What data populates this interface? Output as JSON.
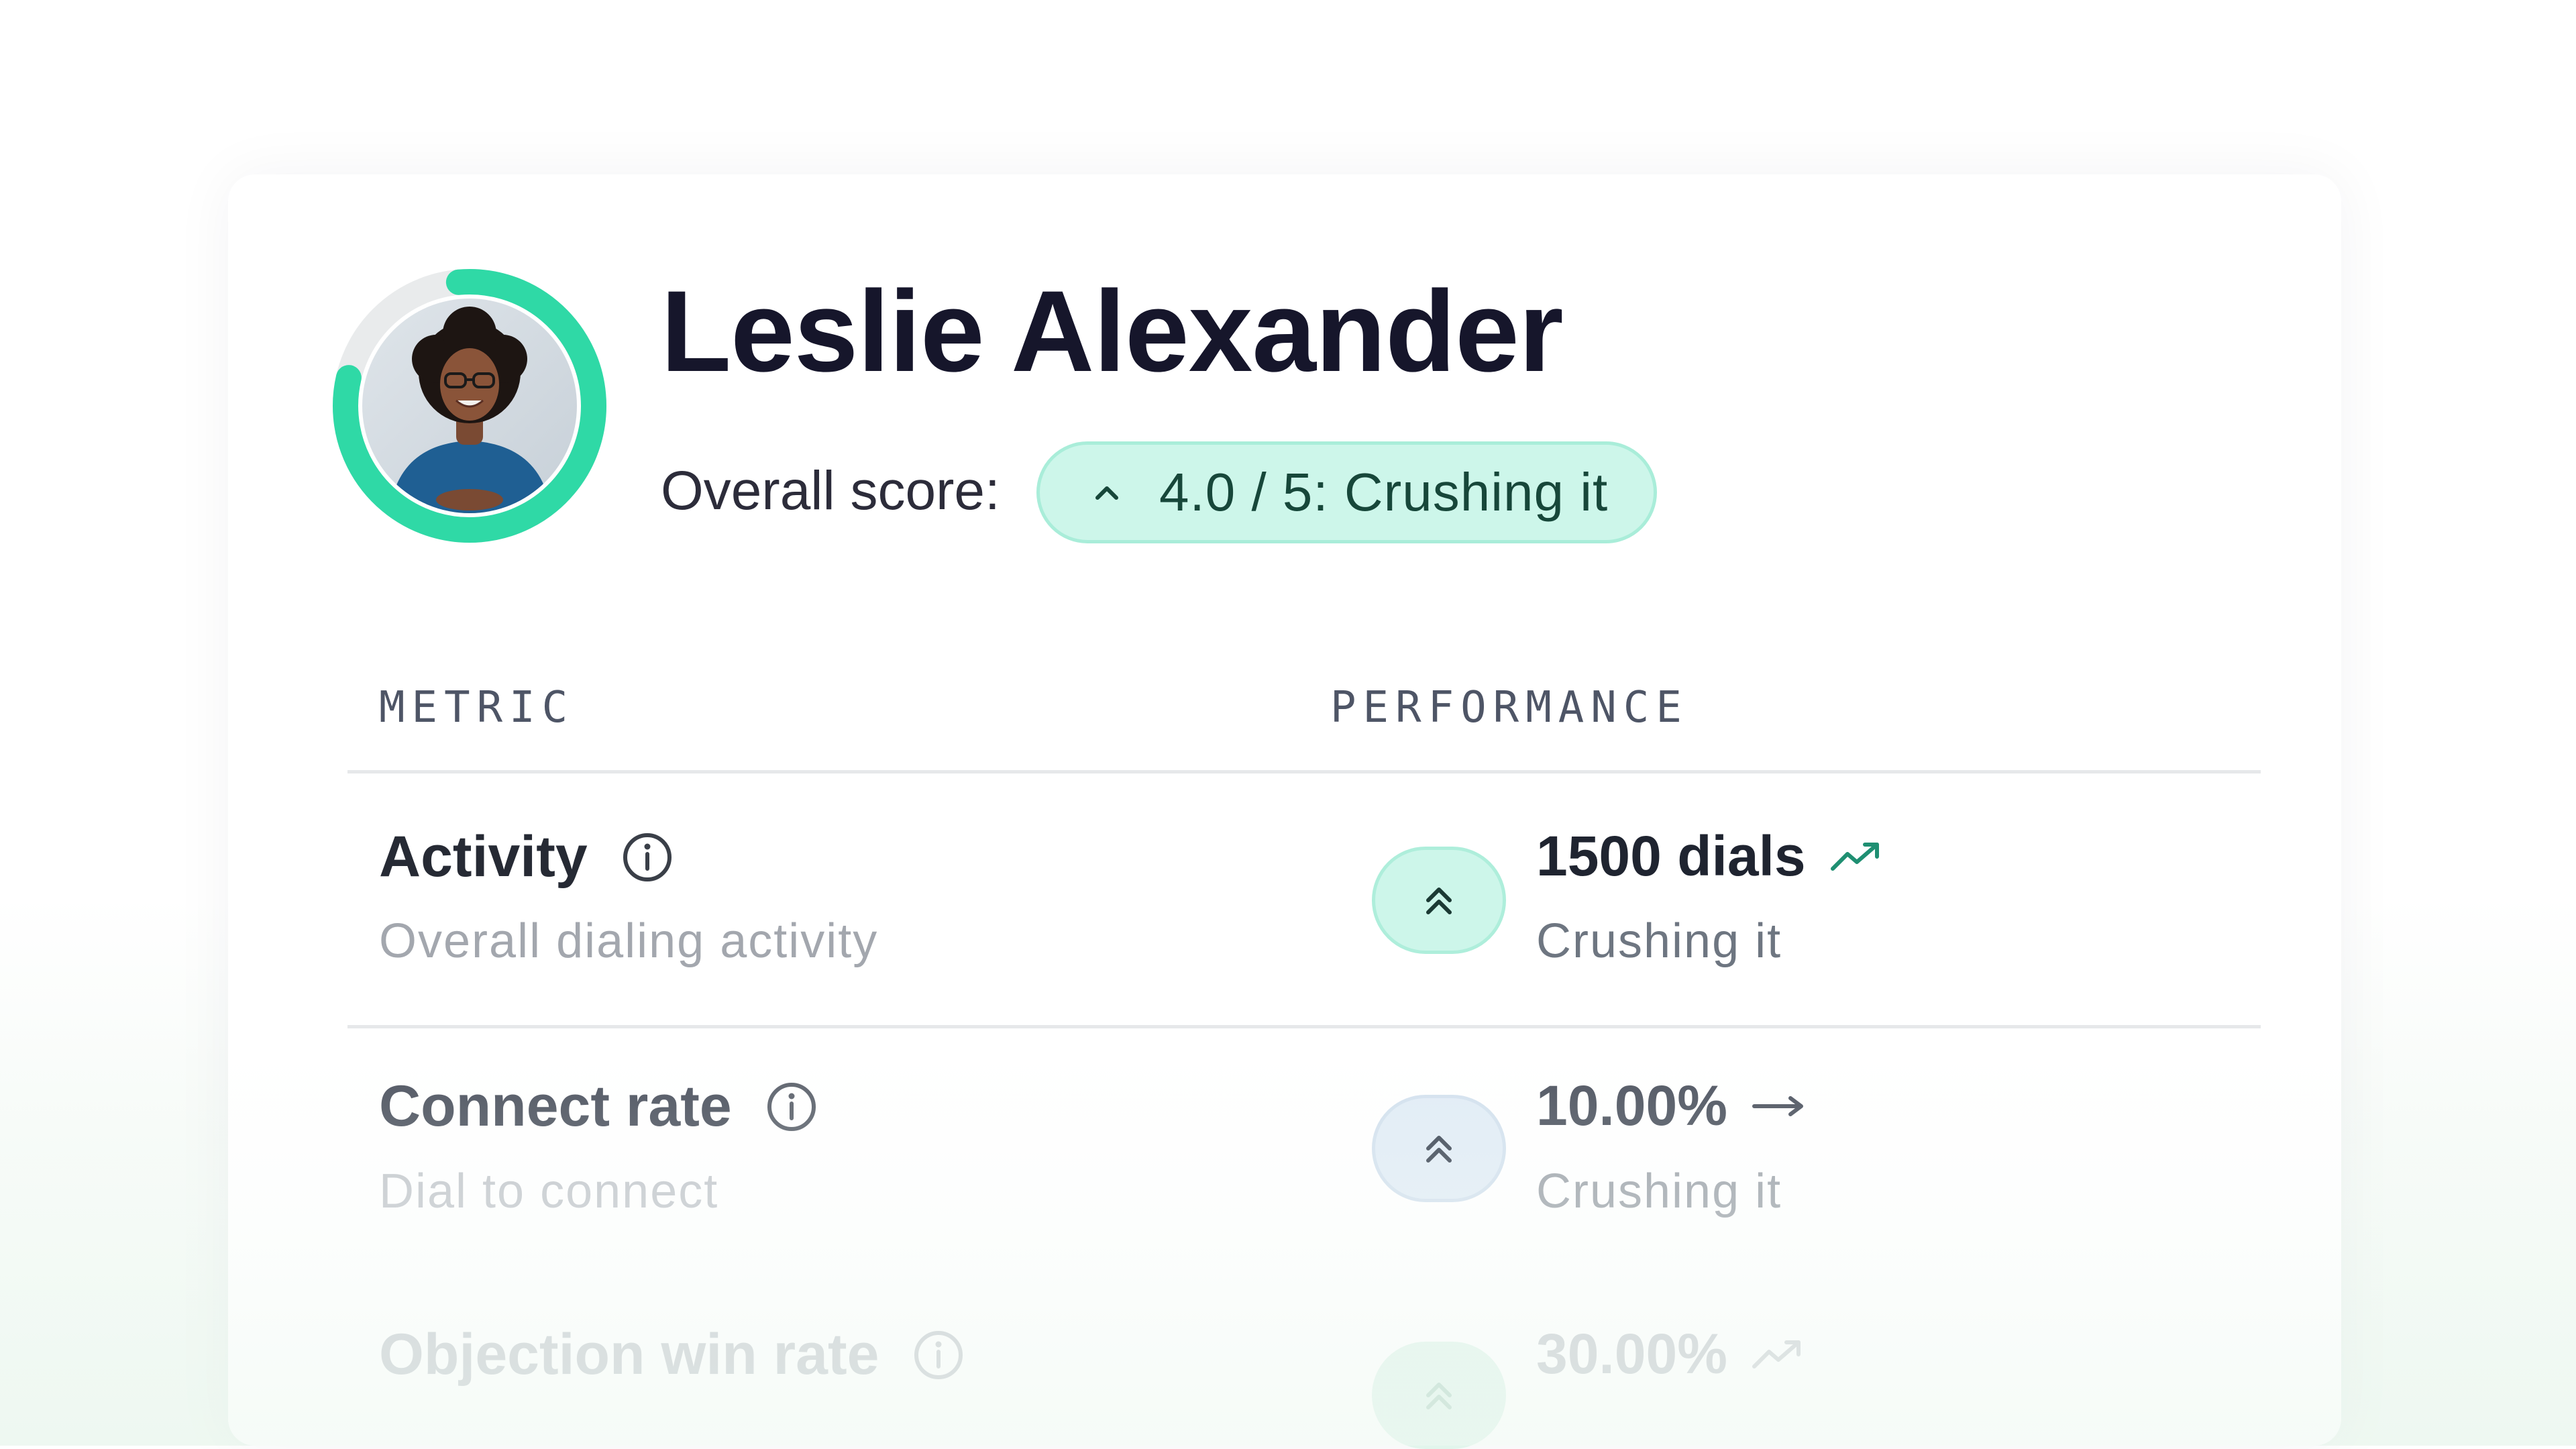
{
  "profile": {
    "name": "Leslie Alexander",
    "score_label": "Overall score:",
    "score_badge": "4.0 / 5: Crushing it",
    "score_ring_fraction": 0.8
  },
  "table": {
    "headers": {
      "metric": "METRIC",
      "performance": "PERFORMANCE"
    },
    "rows": [
      {
        "title": "Activity",
        "subtitle": "Overall dialing activity",
        "value": "1500 dials",
        "status": "Crushing it",
        "trend_icon": "trending-up-icon",
        "level_icon": "double-chevron-up-icon"
      },
      {
        "title": "Connect rate",
        "subtitle": "Dial to connect",
        "value": "10.00%",
        "status": "Crushing it",
        "trend_icon": "arrow-right-icon",
        "level_icon": "double-chevron-up-icon"
      },
      {
        "title": "Objection win rate",
        "subtitle": "",
        "value": "30.00%",
        "status": "",
        "trend_icon": "trending-up-icon",
        "level_icon": "double-chevron-up-icon"
      }
    ]
  },
  "colors": {
    "accent": "#2fd9a6",
    "badge_bg": "#cdf6ea",
    "badge_text": "#17473a",
    "neutral_badge_bg": "#e1ecf6",
    "trend_green": "#1f8f72"
  }
}
